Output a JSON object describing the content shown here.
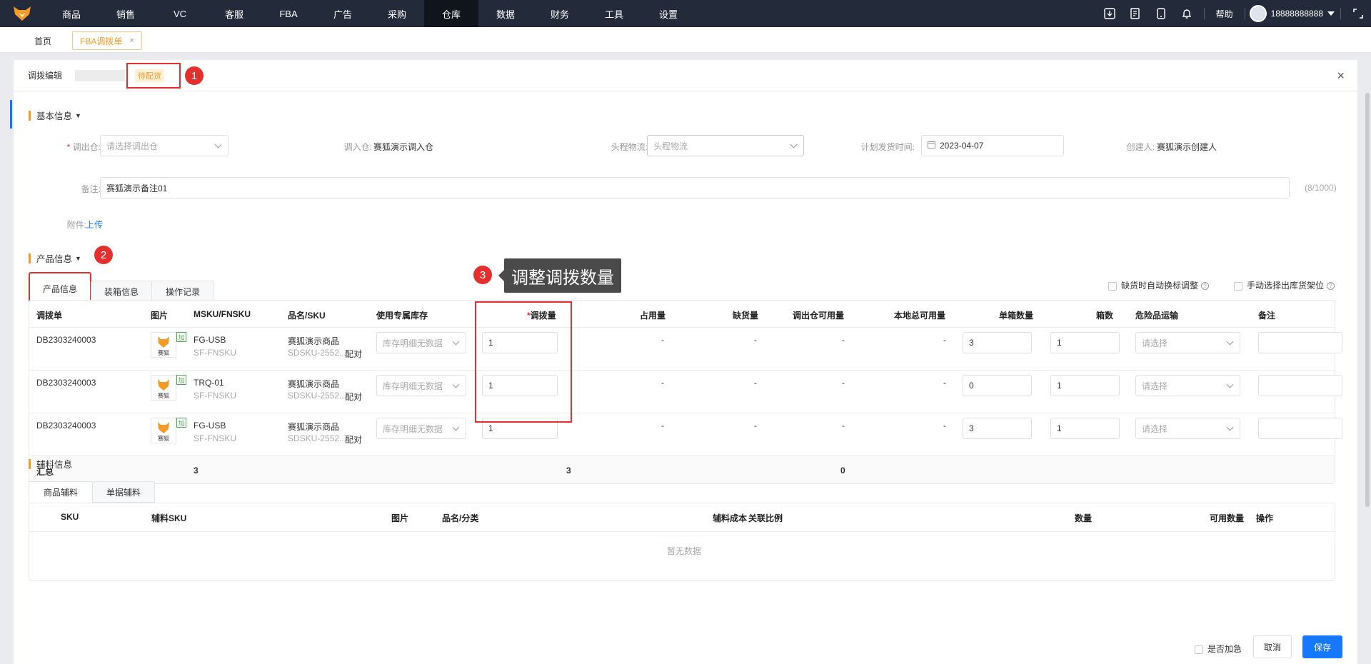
{
  "nav": {
    "items": [
      "商品",
      "销售",
      "VC",
      "客服",
      "FBA",
      "广告",
      "采购",
      "仓库",
      "数据",
      "财务",
      "工具",
      "设置"
    ],
    "active_index": 7,
    "help": "帮助",
    "user": "18888888888"
  },
  "tabs": {
    "home": "首页",
    "current": "FBA调拨单",
    "close": "×"
  },
  "modal": {
    "title": "调拨编辑",
    "status": "待配货",
    "close": "×",
    "steps": [
      "1",
      "2",
      "3"
    ]
  },
  "basic": {
    "section_title": "基本信息",
    "out_wh_label": "调出仓:",
    "out_wh_placeholder": "请选择调出仓",
    "in_wh_label": "调入仓:",
    "in_wh_value": "赛狐演示调入仓",
    "logistics_label": "头程物流:",
    "logistics_placeholder": "头程物流",
    "ship_time_label": "计划发货时间:",
    "ship_time_value": "2023-04-07",
    "creator_label": "创建人:",
    "creator_value": "赛狐演示创建人",
    "remark_label": "备注:",
    "remark_value": "赛狐演示备注01",
    "remark_count": "(8/1000)",
    "attach_label": "附件:",
    "upload": "上传"
  },
  "product": {
    "section_title": "产品信息",
    "tabs": [
      "产品信息",
      "装箱信息",
      "操作记录"
    ],
    "auto_adjust": "缺货时自动换标调整",
    "manual_select": "手动选择出库货架位",
    "tooltip": "调整调拨数量",
    "columns": [
      "调拨单",
      "图片",
      "MSKU/FNSKU",
      "品名/SKU",
      "使用专属库存",
      "调拨量",
      "占用量",
      "缺货量",
      "调出仓可用量",
      "本地总可用量",
      "单箱数量",
      "箱数",
      "危险品运输",
      "备注"
    ],
    "rows": [
      {
        "order": "DB2303240003",
        "msku": "FG-USB",
        "fnsku": "SF-FNSKU",
        "name": "赛狐演示商品",
        "sku": "SDSKU-2552...",
        "pair": "配对",
        "stock": "库存明细无数据",
        "qty": "1",
        "occupied": "-",
        "short": "-",
        "out_avail": "-",
        "local_avail": "-",
        "per_box": "3",
        "boxes": "1",
        "danger": "请选择",
        "note": ""
      },
      {
        "order": "DB2303240003",
        "msku": "TRQ-01",
        "fnsku": "SF-FNSKU",
        "name": "赛狐演示商品",
        "sku": "SDSKU-2552...",
        "pair": "配对",
        "stock": "库存明细无数据",
        "qty": "1",
        "occupied": "-",
        "short": "-",
        "out_avail": "-",
        "local_avail": "-",
        "per_box": "0",
        "boxes": "1",
        "danger": "请选择",
        "note": ""
      },
      {
        "order": "DB2303240003",
        "msku": "FG-USB",
        "fnsku": "SF-FNSKU",
        "name": "赛狐演示商品",
        "sku": "SDSKU-2552...",
        "pair": "配对",
        "stock": "库存明细无数据",
        "qty": "1",
        "occupied": "-",
        "short": "-",
        "out_avail": "-",
        "local_avail": "-",
        "per_box": "3",
        "boxes": "1",
        "danger": "请选择",
        "note": ""
      }
    ],
    "img_label": "赛狐",
    "add_tag": "加",
    "summary": {
      "label": "汇总",
      "msku_count": "3",
      "qty_total": "3",
      "out_avail_total": "0"
    }
  },
  "aux": {
    "section_title": "辅料信息",
    "tabs": [
      "商品辅料",
      "单据辅料"
    ],
    "columns": [
      "SKU",
      "辅料SKU",
      "图片",
      "品名/分类",
      "辅料成本",
      "关联比例",
      "数量",
      "可用数量",
      "操作"
    ],
    "empty": "暂无数据"
  },
  "footer": {
    "urgent": "是否加急",
    "cancel": "取消",
    "save": "保存"
  },
  "colors": {
    "brand": "#f39b25",
    "primary": "#1677ff",
    "highlight": "#e3302f",
    "navbar": "#232a39"
  }
}
